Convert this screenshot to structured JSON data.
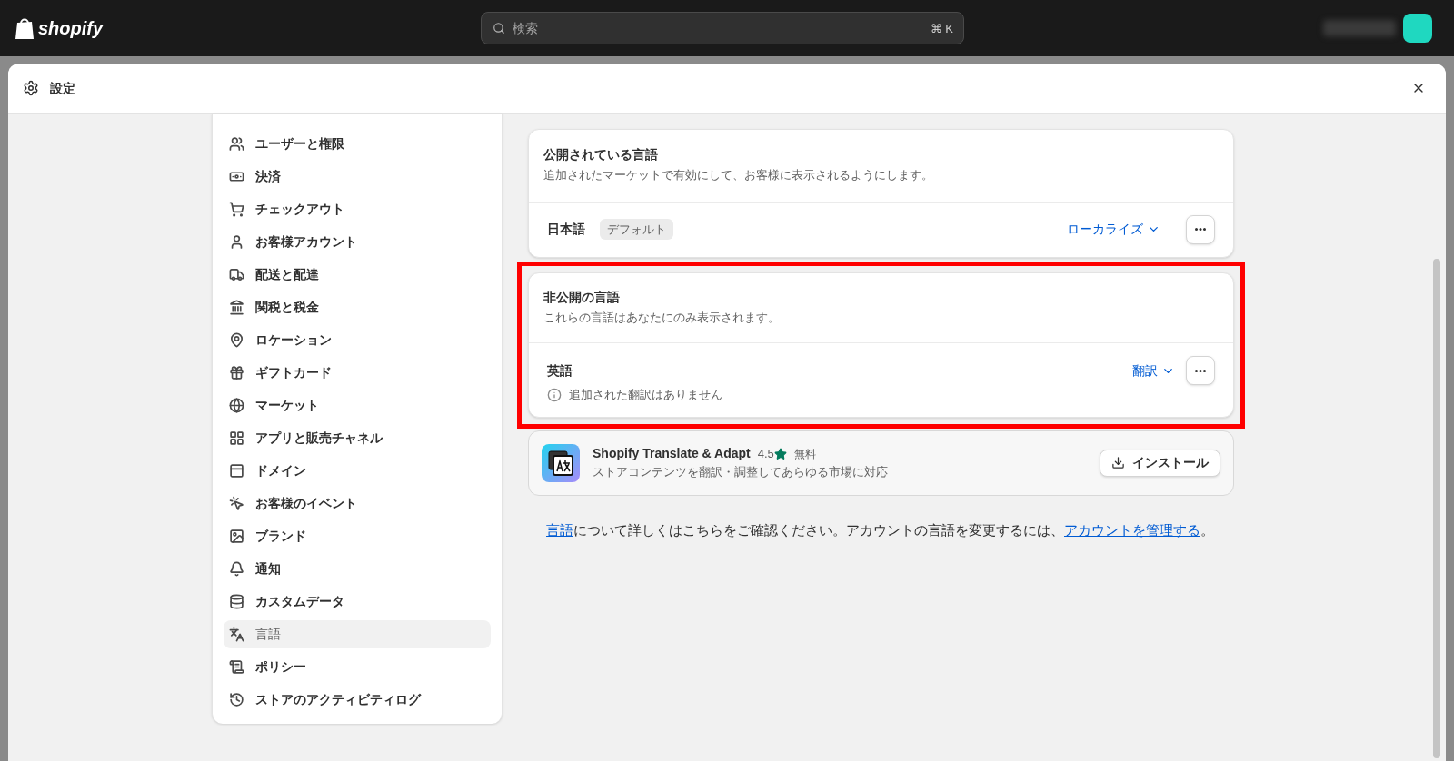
{
  "topbar": {
    "logo": "shopify",
    "search": {
      "placeholder": "検索",
      "shortcut": "⌘ K"
    }
  },
  "modal": {
    "title": "設定"
  },
  "sidebar": {
    "items": [
      {
        "label": "ユーザーと権限",
        "selected": false
      },
      {
        "label": "決済",
        "selected": false
      },
      {
        "label": "チェックアウト",
        "selected": false
      },
      {
        "label": "お客様アカウント",
        "selected": false
      },
      {
        "label": "配送と配達",
        "selected": false
      },
      {
        "label": "関税と税金",
        "selected": false
      },
      {
        "label": "ロケーション",
        "selected": false
      },
      {
        "label": "ギフトカード",
        "selected": false
      },
      {
        "label": "マーケット",
        "selected": false
      },
      {
        "label": "アプリと販売チャネル",
        "selected": false
      },
      {
        "label": "ドメイン",
        "selected": false
      },
      {
        "label": "お客様のイベント",
        "selected": false
      },
      {
        "label": "ブランド",
        "selected": false
      },
      {
        "label": "通知",
        "selected": false
      },
      {
        "label": "カスタムデータ",
        "selected": false
      },
      {
        "label": "言語",
        "selected": true
      },
      {
        "label": "ポリシー",
        "selected": false
      },
      {
        "label": "ストアのアクティビティログ",
        "selected": false
      }
    ]
  },
  "published": {
    "title": "公開されている言語",
    "description": "追加されたマーケットで有効にして、お客様に表示されるようにします。",
    "language": "日本語",
    "badge": "デフォルト",
    "action": "ローカライズ"
  },
  "unpublished": {
    "highlighted": true,
    "title": "非公開の言語",
    "description": "これらの言語はあなたにのみ表示されます。",
    "language": "英語",
    "action": "翻訳",
    "note": "追加された翻訳はありません"
  },
  "app": {
    "name": "Shopify Translate & Adapt",
    "rating": "4.5",
    "price": "無料",
    "description": "ストアコンテンツを翻訳・調整してあらゆる市場に対応",
    "button": "インストール"
  },
  "footer": [
    {
      "kind": "link",
      "text": "言語"
    },
    {
      "kind": "text",
      "text": "について詳しくはこちらをご確認ください。アカウントの言語を変更するには、"
    },
    {
      "kind": "link",
      "text": "アカウントを管理する"
    },
    {
      "kind": "text",
      "text": "。"
    }
  ]
}
